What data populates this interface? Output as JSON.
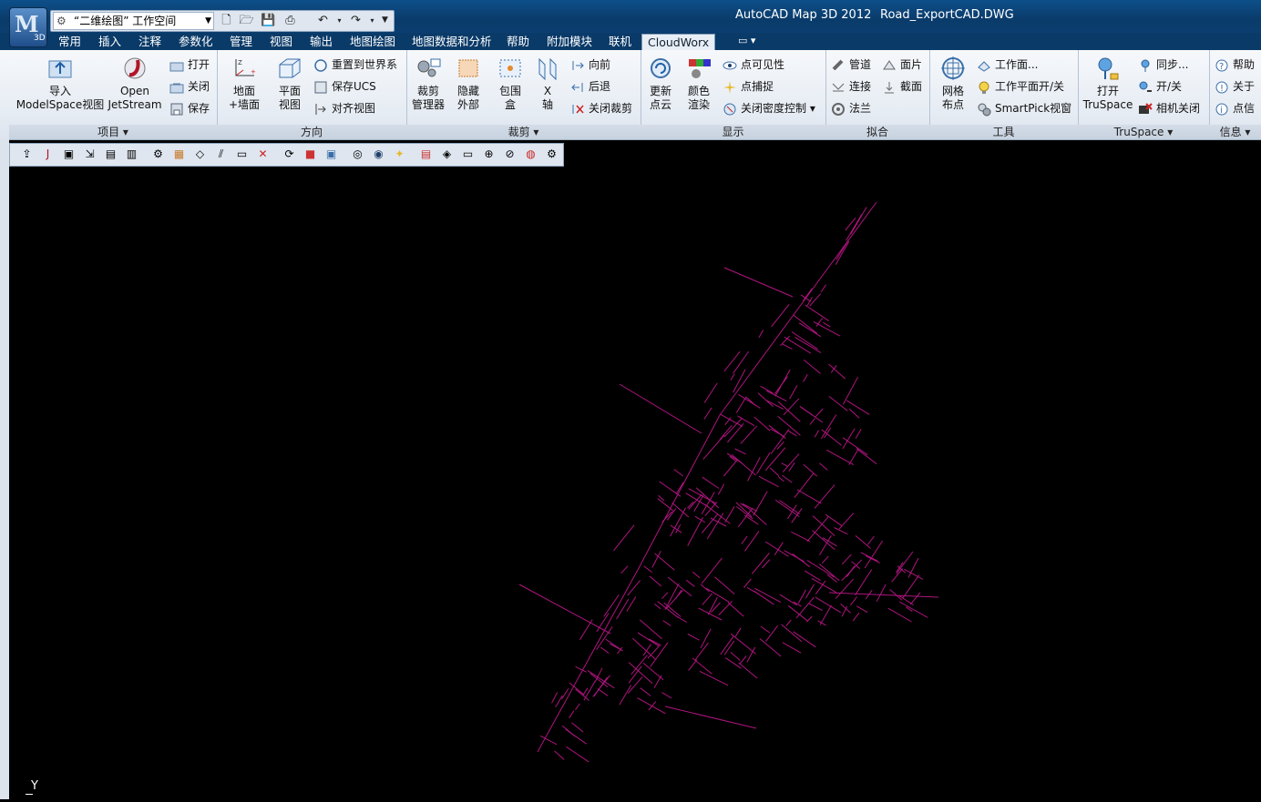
{
  "titlebar": {
    "app_title": "AutoCAD Map 3D 2012",
    "doc_title": "Road_ExportCAD.DWG",
    "workspace": "“二维绘图” 工作空间",
    "app_button_label": "3D"
  },
  "tabs": [
    "常用",
    "插入",
    "注释",
    "参数化",
    "管理",
    "视图",
    "输出",
    "地图绘图",
    "地图数据和分析",
    "帮助",
    "附加模块",
    "联机",
    "CloudWorx"
  ],
  "active_tab": "CloudWorx",
  "panels": {
    "project": {
      "title": "项目",
      "import_label1": "导入",
      "import_label2": "ModelSpace视图",
      "open_label1": "Open",
      "open_label2": "JetStream",
      "open": "打开",
      "close": "关闭",
      "save": "保存"
    },
    "orientation": {
      "title": "方向",
      "ground_label1": "地面",
      "ground_label2": "+墙面",
      "plan_label1": "平面",
      "plan_label2": "视图",
      "reset_world": "重置到世界系",
      "save_ucs": "保存UCS",
      "align_view": "对齐视图"
    },
    "clip": {
      "title": "裁剪",
      "clip_mgr1": "裁剪",
      "clip_mgr2": "管理器",
      "hide1": "隐藏",
      "hide2": "外部",
      "box1": "包围",
      "box2": "盒",
      "xaxis1": "X",
      "xaxis2": "轴",
      "forward": "向前",
      "back": "后退",
      "close_clip": "关闭裁剪"
    },
    "display": {
      "title": "显示",
      "update1": "更新",
      "update2": "点云",
      "color1": "颜色",
      "color2": "渲染",
      "visibility": "点可见性",
      "snap": "点捕捉",
      "density": "关闭密度控制"
    },
    "fit": {
      "title": "拟合",
      "pipe": "管道",
      "patch": "面片",
      "connect": "连接",
      "section": "截面",
      "flange": "法兰"
    },
    "tools": {
      "title": "工具",
      "grid1": "网格",
      "grid2": "布点",
      "workplane": "工作面...",
      "workplane_toggle": "工作平面开/关",
      "smartpick": "SmartPick视窗"
    },
    "truspace": {
      "title": "TruSpace",
      "open1": "打开",
      "open2": "TruSpace",
      "sync": "同步...",
      "toggle": "开/关",
      "camera_off": "相机关闭"
    },
    "info": {
      "title": "信息",
      "help": "帮助",
      "about": "关于",
      "point_info": "点信"
    }
  },
  "canvas": {
    "ucs_label": "Y",
    "line_color": "#b0147f"
  }
}
